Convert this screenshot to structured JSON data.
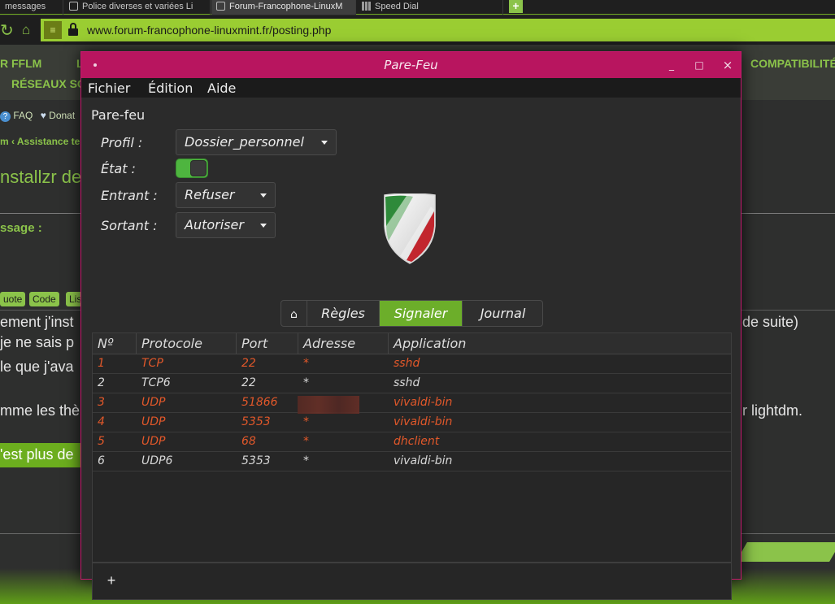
{
  "browser": {
    "tabs": [
      {
        "label": "messages"
      },
      {
        "label": "Police diverses et variées Li"
      },
      {
        "label": "Forum-Francophone-LinuxM"
      },
      {
        "label": "Speed Dial"
      }
    ],
    "new_tab": "+",
    "url": "www.forum-francophone-linuxmint.fr/posting.php",
    "ext_icon": "≡"
  },
  "webpage": {
    "nav_left": "R FFLM",
    "nav_l": "L",
    "nav_right": "COMPATIBILITÉ",
    "nav_row2": "RÉSEAUX SO",
    "links": {
      "faq": "FAQ",
      "donate": "Donat"
    },
    "breadcrumb": "m ‹ Assistance te",
    "topic_title": "nstallzr de",
    "message_label": "ssage :",
    "bbcode": [
      "uote",
      "Code",
      "Lis"
    ],
    "post_lines": [
      "ement j'inst",
      "je ne sais p",
      "le que j'ava",
      "mme les thè",
      "'est plus de"
    ],
    "post_right": [
      " de suite)",
      "r lightdm."
    ]
  },
  "window": {
    "title": "Pare-Feu",
    "controls": {
      "minimize": "_",
      "maximize": "□",
      "close": "×"
    },
    "menu": [
      "Fichier",
      "Édition",
      "Aide"
    ],
    "section_title": "Pare-feu",
    "profile_label": "Profil :",
    "profile_value": "Dossier_personnel",
    "state_label": "État :",
    "state_on": true,
    "incoming_label": "Entrant :",
    "incoming_value": "Refuser",
    "outgoing_label": "Sortant :",
    "outgoing_value": "Autoriser",
    "tabs": {
      "home_icon": "⌂",
      "rules": "Règles",
      "report": "Signaler",
      "log": "Journal",
      "selected": "report"
    },
    "table": {
      "columns": [
        "Nº",
        "Protocole",
        "Port",
        "Adresse",
        "Application"
      ],
      "rows": [
        {
          "no": "1",
          "proto": "TCP",
          "port": "22",
          "addr": "*",
          "app": "sshd",
          "warn": true
        },
        {
          "no": "2",
          "proto": "TCP6",
          "port": "22",
          "addr": "*",
          "app": "sshd",
          "warn": false
        },
        {
          "no": "3",
          "proto": "UDP",
          "port": "51866",
          "addr": "",
          "app": "vivaldi-bin",
          "warn": true
        },
        {
          "no": "4",
          "proto": "UDP",
          "port": "5353",
          "addr": "*",
          "app": "vivaldi-bin",
          "warn": true
        },
        {
          "no": "5",
          "proto": "UDP",
          "port": "68",
          "addr": "*",
          "app": "dhclient",
          "warn": true
        },
        {
          "no": "6",
          "proto": "UDP6",
          "port": "5353",
          "addr": "*",
          "app": "vivaldi-bin",
          "warn": false
        }
      ]
    },
    "add_label": "+"
  },
  "colors": {
    "accent": "#8bc34a",
    "titlebar": "#b8155f",
    "warn": "#e2582a"
  }
}
